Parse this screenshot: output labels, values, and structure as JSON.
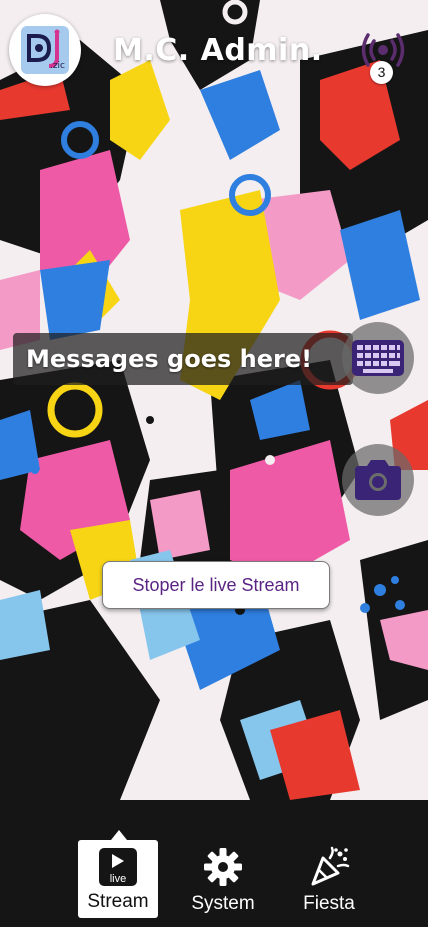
{
  "app": {
    "logo_text": ".zic",
    "title": "M.C. Admin."
  },
  "header": {
    "broadcast_count": "3"
  },
  "overlay": {
    "message": "Messages goes here!",
    "stop_stream_label": "Stoper le live Stream"
  },
  "icons": {
    "keyboard": "keyboard-icon",
    "camera": "camera-icon",
    "broadcast": "broadcast-icon"
  },
  "nav": {
    "items": [
      {
        "label": "Stream",
        "icon": "live-play-icon",
        "active": true
      },
      {
        "label": "System",
        "icon": "gear-icon",
        "active": false
      },
      {
        "label": "Fiesta",
        "icon": "party-popper-icon",
        "active": false
      }
    ],
    "live_badge": "live"
  },
  "colors": {
    "accent_purple": "#3a2475",
    "button_text": "#5a2485",
    "nav_background": "#151515"
  }
}
